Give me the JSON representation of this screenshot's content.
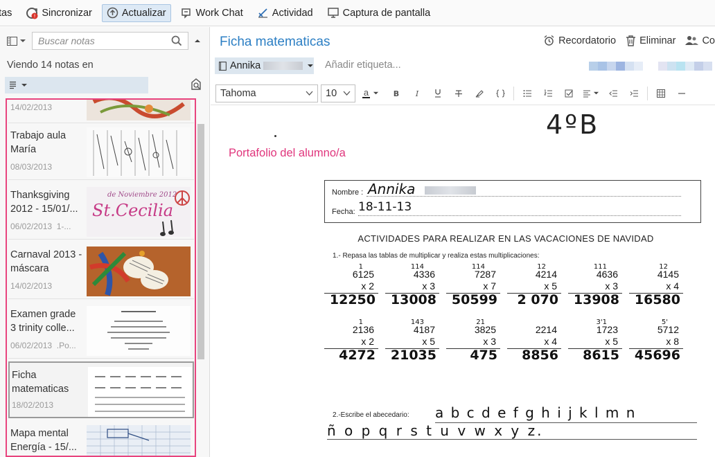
{
  "toolbar": {
    "first_partial": "tas",
    "items": [
      {
        "label": "Sincronizar",
        "icon": "sync-icon"
      },
      {
        "label": "Actualizar",
        "icon": "upgrade-icon"
      },
      {
        "label": "Work Chat",
        "icon": "work-chat-icon"
      },
      {
        "label": "Actividad",
        "icon": "activity-icon"
      },
      {
        "label": "Captura de pantalla",
        "icon": "screenshot-icon"
      }
    ]
  },
  "left_panel": {
    "search_placeholder": "Buscar notas",
    "viewing_label": "Viendo 14 notas en",
    "notes": [
      {
        "title": "",
        "date": "14/02/2013",
        "meta": ""
      },
      {
        "title": "Trabajo aula María",
        "date": "08/03/2013",
        "meta": ""
      },
      {
        "title": "Thanksgiving 2012 - 15/01/...",
        "date": "06/02/2013",
        "meta": "1-..."
      },
      {
        "title": "Carnaval 2013 - máscara",
        "date": "14/02/2013",
        "meta": ""
      },
      {
        "title": "Examen grade 3 trinity colle...",
        "date": "06/02/2013",
        "meta": ".Po..."
      },
      {
        "title": "Ficha matematicas",
        "date": "18/02/2013",
        "meta": ""
      },
      {
        "title": "Mapa mental Energía - 15/...",
        "date": "",
        "meta": ""
      }
    ]
  },
  "note": {
    "title": "Ficha matematicas",
    "actions": [
      {
        "label": "Recordatorio",
        "icon": "alarm-clock-icon"
      },
      {
        "label": "Eliminar",
        "icon": "trash-icon"
      },
      {
        "label": "Co",
        "icon": "people-icon"
      }
    ],
    "notebook": "Annika",
    "tag_placeholder": "Añadir etiqueta...",
    "font": "Tahoma",
    "font_size": "10",
    "text_color_letter": "a",
    "body_heading": "4ºB",
    "portfolio_text": "Portafolio del alumno/a"
  },
  "worksheet": {
    "name_label": "Nombre :",
    "name_value": "Annika",
    "date_label": "Fecha:",
    "date_value": "18-11-13",
    "heading": "ACTIVIDADES PARA REALIZAR EN LAS VACACIONES DE NAVIDAD",
    "instruction1": "1.- Repasa las tablas de multiplicar y realiza estas multiplicaciones:",
    "row1": [
      {
        "carry": "1",
        "top": "6125",
        "mult": "x 2",
        "answer": "12250"
      },
      {
        "carry": "114",
        "top": "4336",
        "mult": "x 3",
        "answer": "13008"
      },
      {
        "carry": "114",
        "top": "7287",
        "mult": "x 7",
        "answer": "50599"
      },
      {
        "carry": "12",
        "top": "4214",
        "mult": "x 5",
        "answer": "2 070"
      },
      {
        "carry": "111",
        "top": "4636",
        "mult": "x 3",
        "answer": "13908"
      },
      {
        "carry": "12",
        "top": "4145",
        "mult": "x 4",
        "answer": "16580"
      }
    ],
    "row2": [
      {
        "carry": "1",
        "top": "2136",
        "mult": "x 2",
        "answer": "4272"
      },
      {
        "carry": "143",
        "top": "4187",
        "mult": "x 5",
        "answer": "21035"
      },
      {
        "carry": "21",
        "top": "3825",
        "mult": "x 3",
        "answer": "475"
      },
      {
        "carry": "",
        "top": "2214",
        "mult": "x 4",
        "answer": "8856"
      },
      {
        "carry": "3'1",
        "top": "1723",
        "mult": "x 5",
        "answer": "8615"
      },
      {
        "carry": "5'",
        "top": "5712",
        "mult": "x 8",
        "answer": "45696"
      }
    ],
    "instruction2": "2.-Escribe el abecedario:",
    "alphabet_line1": "a b c d e f g h i j k l m n",
    "alphabet_line2": "ñ o p q r s t u v w x y z."
  }
}
